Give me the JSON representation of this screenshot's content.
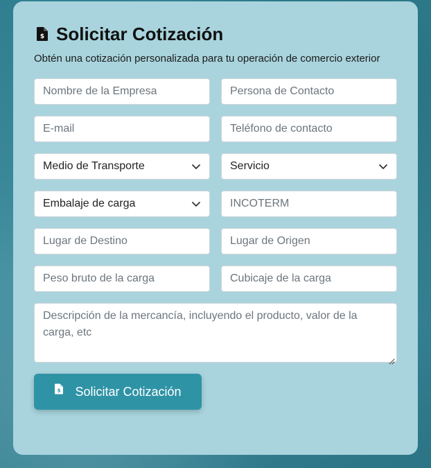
{
  "form": {
    "title": "Solicitar Cotización",
    "subtitle": "Obtén una cotización personalizada para tu operación de comercio exterior",
    "title_icon": "file-invoice-dollar-icon",
    "fields": {
      "company": {
        "placeholder": "Nombre de la Empresa"
      },
      "contact": {
        "placeholder": "Persona de Contacto"
      },
      "email": {
        "placeholder": "E-mail"
      },
      "phone": {
        "placeholder": "Teléfono de contacto"
      },
      "transport": {
        "selected": "Medio de Transporte"
      },
      "service": {
        "selected": "Servicio"
      },
      "packaging": {
        "selected": "Embalaje de carga"
      },
      "incoterm": {
        "placeholder": "INCOTERM"
      },
      "destination": {
        "placeholder": "Lugar de Destino"
      },
      "origin": {
        "placeholder": "Lugar de Origen"
      },
      "weight": {
        "placeholder": "Peso bruto de la carga"
      },
      "volume": {
        "placeholder": "Cubicaje de la carga"
      },
      "description": {
        "placeholder": "Descripción de la mercancía, incluyendo el producto, valor de la carga, etc"
      }
    },
    "submit_label": "Solicitar Cotización"
  },
  "colors": {
    "card_bg": "#a9d4dd",
    "button_bg": "#2f93a6",
    "background": "#3f8d9e"
  }
}
